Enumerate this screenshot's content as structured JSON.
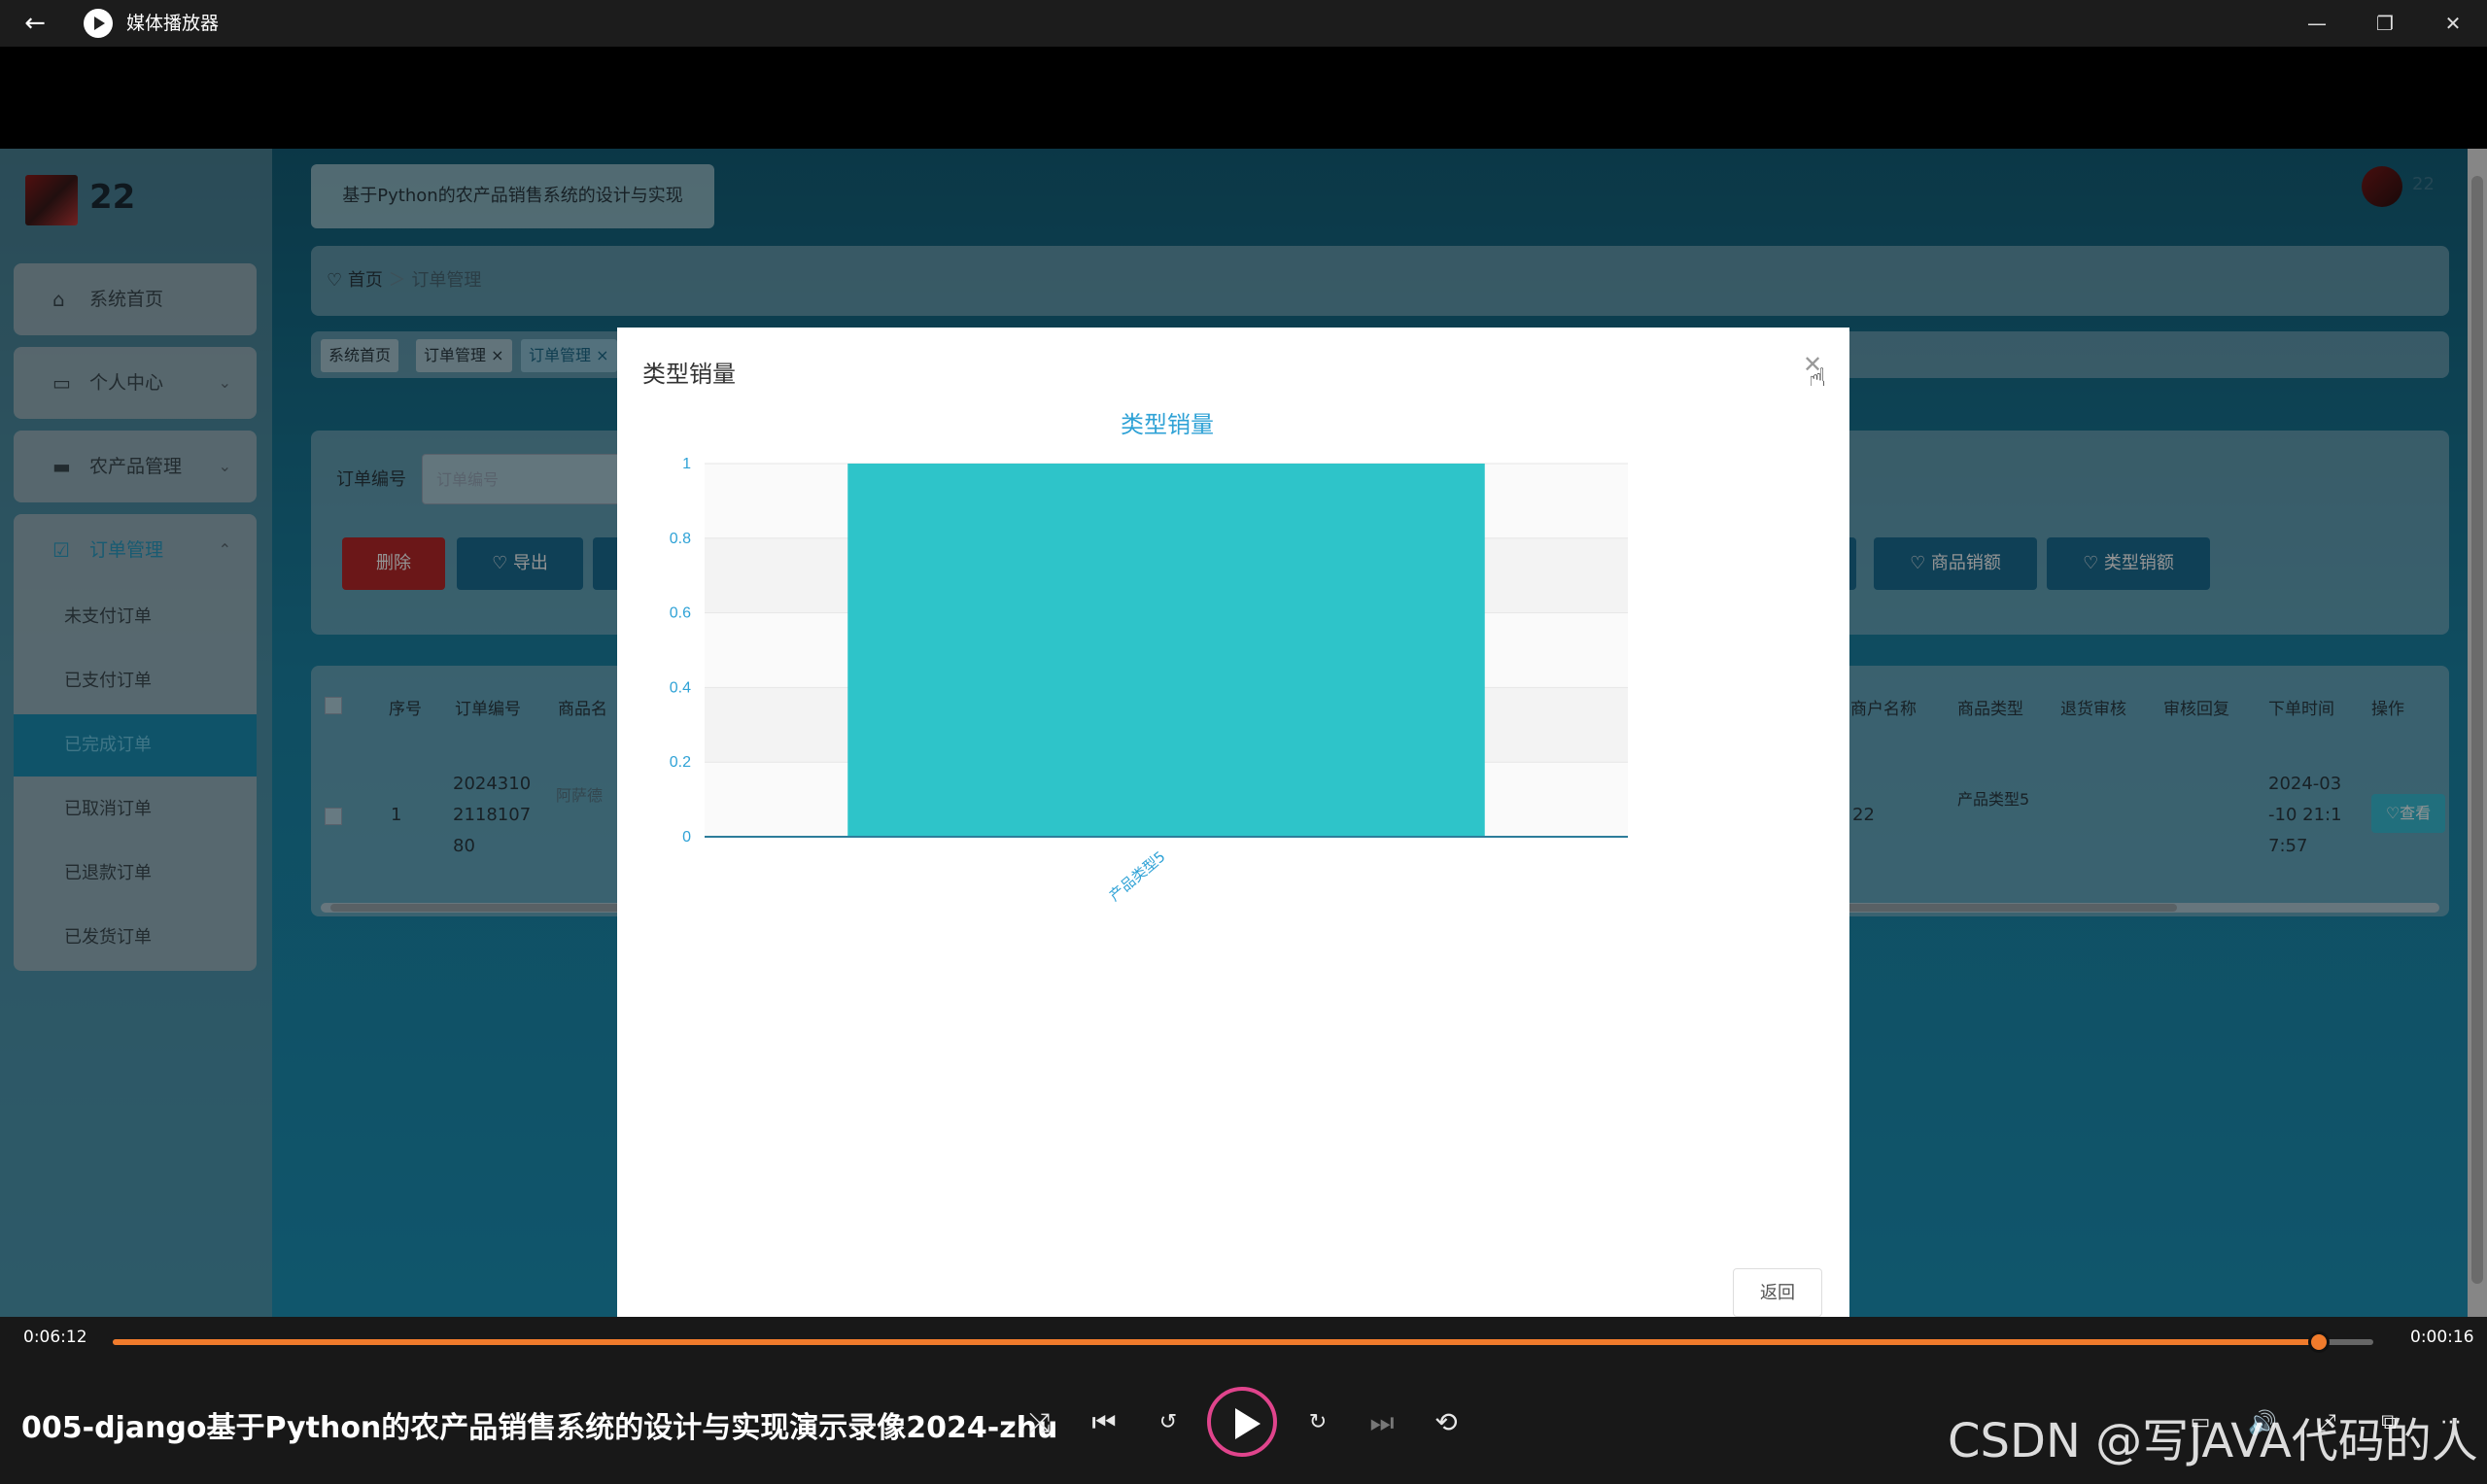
{
  "player": {
    "app_title": "媒体播放器",
    "time_elapsed": "0:06:12",
    "time_remaining": "0:00:16",
    "progress_fraction": 0.976,
    "video_title": "005-django基于Python的农产品销售系统的设计与实现演示录像2024-zhu",
    "watermark": "CSDN @写JAVA代码的人"
  },
  "admin": {
    "user_name": "22",
    "system_title": "基于Python的农产品销售系统的设计与实现",
    "menu": [
      {
        "label": "系统首页"
      },
      {
        "label": "个人中心"
      },
      {
        "label": "农产品管理"
      },
      {
        "label": "订单管理"
      }
    ],
    "submenu": [
      "未支付订单",
      "已支付订单",
      "已完成订单",
      "已取消订单",
      "已退款订单",
      "已发货订单"
    ],
    "breadcrumb": {
      "home": "首页",
      "current": "订单管理"
    },
    "tabs": [
      "系统首页",
      "订单管理",
      "订单管理"
    ],
    "search": {
      "label": "订单编号",
      "placeholder": "订单编号"
    },
    "buttons": {
      "delete": "删除",
      "export": "导出",
      "goods_sales": "商品销额",
      "type_sales": "类型销额"
    },
    "table": {
      "headers": [
        "序号",
        "订单编号",
        "商品名",
        "商户名称",
        "商品类型",
        "退货审核",
        "审核回复",
        "下单时间",
        "操作"
      ],
      "row": {
        "index": "1",
        "order_no": "2024310211810780",
        "goods": "阿萨德",
        "merchant": "22",
        "type": "产品类型5",
        "time": "2024-03-10 21:17:57",
        "view": "查看"
      }
    }
  },
  "modal": {
    "title": "类型销量",
    "back_label": "返回"
  },
  "chart_data": {
    "type": "bar",
    "title": "类型销量",
    "categories": [
      "产品类型5"
    ],
    "values": [
      1
    ],
    "ylim": [
      0,
      1
    ],
    "yticks": [
      "0",
      "0.2",
      "0.4",
      "0.6",
      "0.8",
      "1"
    ],
    "bar_color": "#2ec4c9",
    "grid": true
  }
}
